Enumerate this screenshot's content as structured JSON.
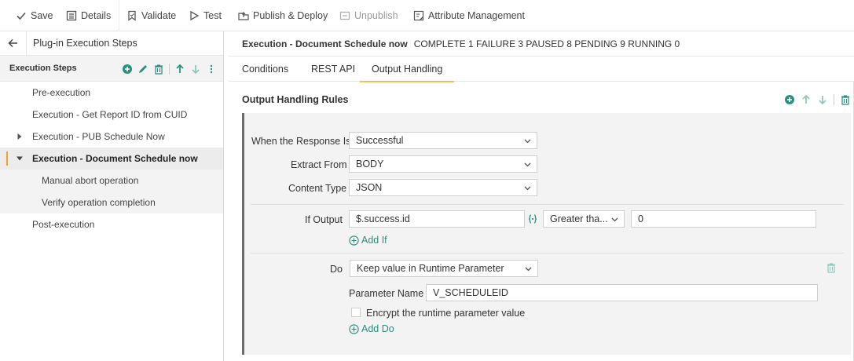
{
  "toolbar": {
    "save": "Save",
    "details": "Details",
    "validate": "Validate",
    "test": "Test",
    "publish": "Publish & Deploy",
    "unpublish": "Unpublish",
    "attribute": "Attribute Management"
  },
  "left": {
    "header_title": "Plug-in Execution Steps",
    "steps_title": "Execution Steps",
    "items": [
      {
        "label": "Pre-execution"
      },
      {
        "label": "Execution - Get Report ID from CUID"
      },
      {
        "label": "Execution - PUB Schedule Now"
      },
      {
        "label": "Execution - Document Schedule now"
      },
      {
        "label": "Manual abort operation"
      },
      {
        "label": "Verify operation completion"
      },
      {
        "label": "Post-execution"
      }
    ]
  },
  "right": {
    "exec_name": "Execution - Document Schedule now",
    "exec_status": "COMPLETE 1 FAILURE 3 PAUSED 8 PENDING 9 RUNNING 0",
    "tabs": [
      "Conditions",
      "REST API",
      "Output Handling"
    ],
    "active_tab": "Output Handling",
    "section_title": "Output Handling Rules",
    "when_label": "When the Response Is",
    "when_value": "Successful",
    "extract_label": "Extract From",
    "extract_value": "BODY",
    "content_label": "Content Type",
    "content_value": "JSON",
    "if_label": "If Output",
    "if_value": "$.success.id",
    "operator_value": "Greater tha...",
    "compare_value": "0",
    "add_if": "Add If",
    "do_label": "Do",
    "do_value": "Keep value in Runtime Parameter",
    "param_label": "Parameter Name",
    "param_value": "V_SCHEDULEID",
    "encrypt_label": "Encrypt the runtime parameter value",
    "add_do": "Add Do"
  },
  "colors": {
    "accent_green": "#2a8f7f",
    "selected_marker": "#f0a030",
    "tab_underline": "#e8c45a"
  }
}
